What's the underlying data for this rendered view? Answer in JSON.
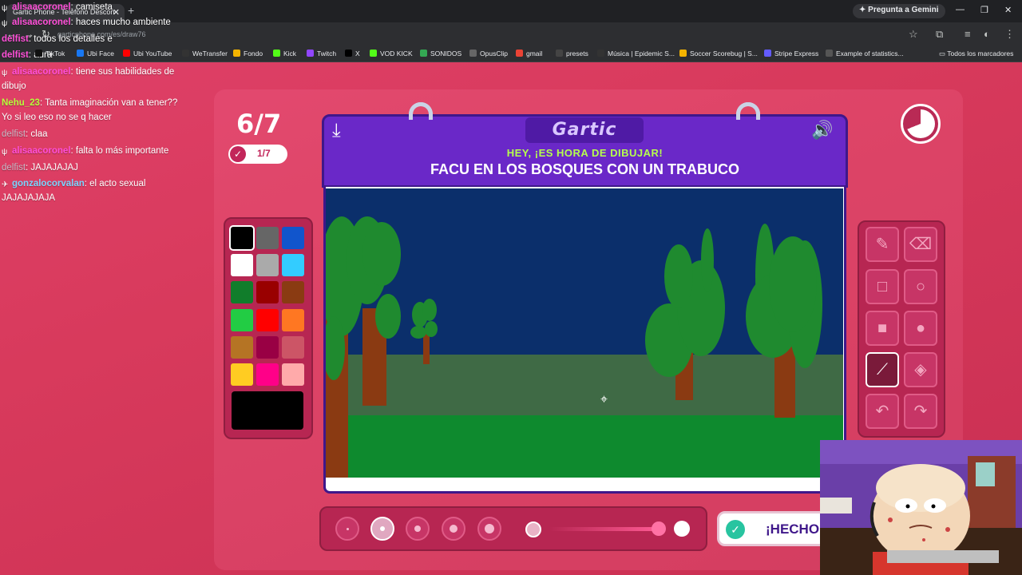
{
  "browser": {
    "tab_title": "Gartic Phone - Teléfono Descon",
    "tab_close": "✕",
    "new_tab": "+",
    "gemini_label": "Pregunta a Gemini",
    "url": "garticphone.com/es/draw76",
    "bookmarks": [
      {
        "label": "TikTok",
        "color": "#111111"
      },
      {
        "label": "Ubi Face",
        "color": "#1877f2"
      },
      {
        "label": "Ubi YouTube",
        "color": "#ff0000"
      },
      {
        "label": "WeTransfer",
        "color": "#333333"
      },
      {
        "label": "Fondo",
        "color": "#f4b400"
      },
      {
        "label": "Kick",
        "color": "#53fc18"
      },
      {
        "label": "Twitch",
        "color": "#9146ff"
      },
      {
        "label": "X",
        "color": "#000000"
      },
      {
        "label": "VOD KICK",
        "color": "#53fc18"
      },
      {
        "label": "SONIDOS",
        "color": "#34a853"
      },
      {
        "label": "OpusClip",
        "color": "#666666"
      },
      {
        "label": "gmail",
        "color": "#ea4335"
      },
      {
        "label": "presets",
        "color": "#444444"
      },
      {
        "label": "Música | Epidemic S...",
        "color": "#333333"
      },
      {
        "label": "Soccer Scorebug | S...",
        "color": "#f4b400"
      },
      {
        "label": "Stripe Express",
        "color": "#635bff"
      },
      {
        "label": "Example of statistics...",
        "color": "#555555"
      }
    ],
    "all_bookmarks": "Todos los marcadores"
  },
  "chat": [
    {
      "user": "alisaacoronel",
      "text": ": camiseta",
      "style": "u-pink",
      "badge": "ψ"
    },
    {
      "user": "alisaacoronel",
      "text": ": haces mucho ambiente",
      "style": "u-pink",
      "badge": "ψ"
    },
    {
      "user": "delfist",
      "text": ": todos los detalles e",
      "style": "u-pink",
      "badge": ""
    },
    {
      "user": "delfist",
      "text": ": aura",
      "style": "u-pink",
      "badge": ""
    },
    {
      "user": "alisaacoronel",
      "text": ": tiene sus habilidades de",
      "style": "u-pink",
      "badge": "ψ"
    },
    {
      "user": "",
      "text": "dibujo",
      "style": "",
      "badge": ""
    },
    {
      "user": "Nehu_23",
      "text": ": Tanta imaginación van a tener??",
      "style": "u-green",
      "badge": ""
    },
    {
      "user": "",
      "text": "Yo si leo eso no se q hacer",
      "style": "",
      "badge": ""
    },
    {
      "user": "delfist",
      "text": ": claa",
      "style": "u-grey",
      "badge": ""
    },
    {
      "user": "alisaacoronel",
      "text": ": falta lo más importante",
      "style": "u-pink",
      "badge": "ψ"
    },
    {
      "user": "delfist",
      "text": ": JAJAJAJAJ",
      "style": "u-grey",
      "badge": ""
    },
    {
      "user": "gonzalocorvalan",
      "text": ": el acto sexual",
      "style": "u-blue",
      "badge": "✈"
    },
    {
      "user": "",
      "text": "JAJAJAJAJA",
      "style": "",
      "badge": ""
    }
  ],
  "game": {
    "round": "6/7",
    "done_count": "1/7",
    "logo": "Gartic",
    "hint": "HEY, ¡ES HORA DE DIBUJAR!",
    "task": "FACU EN LOS BOSQUES CON UN TRABUCO",
    "done_button": "¡HECHO!",
    "timer_fraction_remaining": 0.69,
    "palette": [
      "#000000",
      "#666666",
      "#1155cc",
      "#ffffff",
      "#aaaaaa",
      "#33ccff",
      "#117d2b",
      "#990000",
      "#8a3b12",
      "#22cc44",
      "#ff0000",
      "#ff7722",
      "#b57424",
      "#990044",
      "#cc5566",
      "#ffcc22",
      "#ff0088",
      "#ffaaaa"
    ],
    "selected_color": "#000000",
    "selected_tool": "line",
    "selected_size_index": 1,
    "opacity_level": 0.8
  },
  "icons": {
    "download": "download-icon",
    "sound": "speaker-icon",
    "timer": "timer-icon",
    "done": "check-icon"
  }
}
